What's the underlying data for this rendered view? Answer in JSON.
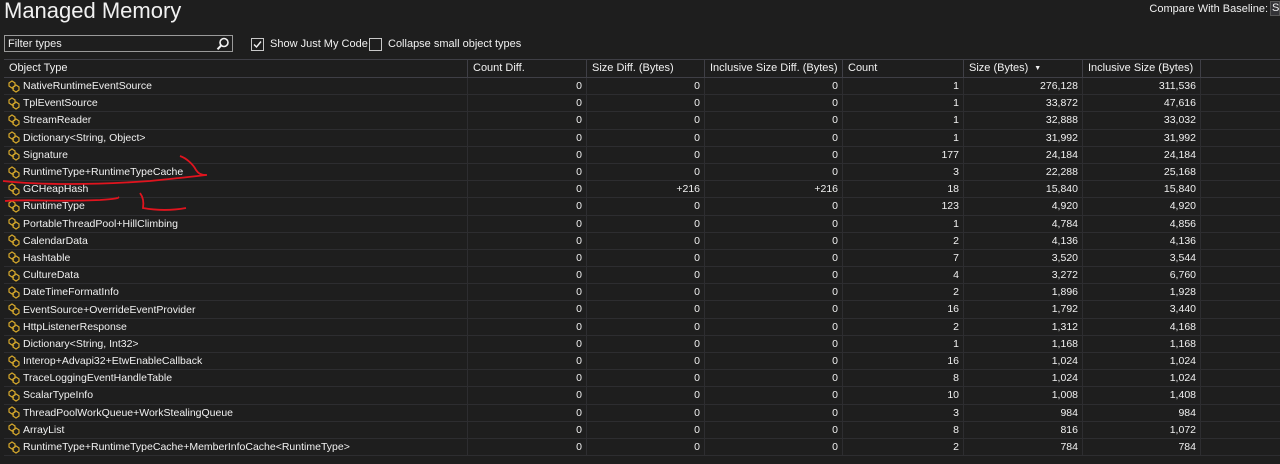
{
  "window": {
    "title": "Managed Memory"
  },
  "compare": {
    "label": "Compare With Baseline:",
    "value": "Se"
  },
  "filter": {
    "placeholder": "Filter types",
    "value": ""
  },
  "options": {
    "show_just_my_code": {
      "label": "Show Just My Code",
      "checked": true
    },
    "collapse_small": {
      "label": "Collapse small object types",
      "checked": false
    }
  },
  "table": {
    "columns": [
      "Object Type",
      "Count Diff.",
      "Size Diff. (Bytes)",
      "Inclusive Size Diff. (Bytes)",
      "Count",
      "Size (Bytes)",
      "Inclusive Size (Bytes)"
    ],
    "sorted_column": "Size (Bytes)",
    "sort_direction": "descending",
    "rows": [
      {
        "type": "NativeRuntimeEventSource",
        "count_diff": "0",
        "size_diff": "0",
        "incl_diff": "0",
        "count": "1",
        "size": "276,128",
        "incl_size": "311,536"
      },
      {
        "type": "TplEventSource",
        "count_diff": "0",
        "size_diff": "0",
        "incl_diff": "0",
        "count": "1",
        "size": "33,872",
        "incl_size": "47,616"
      },
      {
        "type": "StreamReader",
        "count_diff": "0",
        "size_diff": "0",
        "incl_diff": "0",
        "count": "1",
        "size": "32,888",
        "incl_size": "33,032"
      },
      {
        "type": "Dictionary<String, Object>",
        "count_diff": "0",
        "size_diff": "0",
        "incl_diff": "0",
        "count": "1",
        "size": "31,992",
        "incl_size": "31,992"
      },
      {
        "type": "Signature",
        "count_diff": "0",
        "size_diff": "0",
        "incl_diff": "0",
        "count": "177",
        "size": "24,184",
        "incl_size": "24,184"
      },
      {
        "type": "RuntimeType+RuntimeTypeCache",
        "count_diff": "0",
        "size_diff": "0",
        "incl_diff": "0",
        "count": "3",
        "size": "22,288",
        "incl_size": "25,168"
      },
      {
        "type": "GCHeapHash",
        "count_diff": "0",
        "size_diff": "+216",
        "incl_diff": "+216",
        "count": "18",
        "size": "15,840",
        "incl_size": "15,840"
      },
      {
        "type": "RuntimeType",
        "count_diff": "0",
        "size_diff": "0",
        "incl_diff": "0",
        "count": "123",
        "size": "4,920",
        "incl_size": "4,920"
      },
      {
        "type": "PortableThreadPool+HillClimbing",
        "count_diff": "0",
        "size_diff": "0",
        "incl_diff": "0",
        "count": "1",
        "size": "4,784",
        "incl_size": "4,856"
      },
      {
        "type": "CalendarData",
        "count_diff": "0",
        "size_diff": "0",
        "incl_diff": "0",
        "count": "2",
        "size": "4,136",
        "incl_size": "4,136"
      },
      {
        "type": "Hashtable",
        "count_diff": "0",
        "size_diff": "0",
        "incl_diff": "0",
        "count": "7",
        "size": "3,520",
        "incl_size": "3,544"
      },
      {
        "type": "CultureData",
        "count_diff": "0",
        "size_diff": "0",
        "incl_diff": "0",
        "count": "4",
        "size": "3,272",
        "incl_size": "6,760"
      },
      {
        "type": "DateTimeFormatInfo",
        "count_diff": "0",
        "size_diff": "0",
        "incl_diff": "0",
        "count": "2",
        "size": "1,896",
        "incl_size": "1,928"
      },
      {
        "type": "EventSource+OverrideEventProvider",
        "count_diff": "0",
        "size_diff": "0",
        "incl_diff": "0",
        "count": "16",
        "size": "1,792",
        "incl_size": "3,440"
      },
      {
        "type": "HttpListenerResponse",
        "count_diff": "0",
        "size_diff": "0",
        "incl_diff": "0",
        "count": "2",
        "size": "1,312",
        "incl_size": "4,168"
      },
      {
        "type": "Dictionary<String, Int32>",
        "count_diff": "0",
        "size_diff": "0",
        "incl_diff": "0",
        "count": "1",
        "size": "1,168",
        "incl_size": "1,168"
      },
      {
        "type": "Interop+Advapi32+EtwEnableCallback",
        "count_diff": "0",
        "size_diff": "0",
        "incl_diff": "0",
        "count": "16",
        "size": "1,024",
        "incl_size": "1,024"
      },
      {
        "type": "TraceLoggingEventHandleTable",
        "count_diff": "0",
        "size_diff": "0",
        "incl_diff": "0",
        "count": "8",
        "size": "1,024",
        "incl_size": "1,024"
      },
      {
        "type": "ScalarTypeInfo",
        "count_diff": "0",
        "size_diff": "0",
        "incl_diff": "0",
        "count": "10",
        "size": "1,008",
        "incl_size": "1,408"
      },
      {
        "type": "ThreadPoolWorkQueue+WorkStealingQueue",
        "count_diff": "0",
        "size_diff": "0",
        "incl_diff": "0",
        "count": "3",
        "size": "984",
        "incl_size": "984"
      },
      {
        "type": "ArrayList",
        "count_diff": "0",
        "size_diff": "0",
        "incl_diff": "0",
        "count": "8",
        "size": "816",
        "incl_size": "1,072"
      },
      {
        "type": "RuntimeType+RuntimeTypeCache+MemberInfoCache<RuntimeType>",
        "count_diff": "0",
        "size_diff": "0",
        "incl_diff": "0",
        "count": "2",
        "size": "784",
        "incl_size": "784"
      }
    ]
  },
  "annotations": {
    "mark_1": "1",
    "mark_2": "1",
    "color": "#e0141e"
  },
  "icons": {
    "type_icon": "class-type-icon",
    "search": "search-icon",
    "sort": "sort-descending-icon"
  },
  "colors": {
    "background": "#1e1e1e",
    "text": "#f1f1f1",
    "gridline": "#3f3f46",
    "icon": "#d4a72c"
  }
}
